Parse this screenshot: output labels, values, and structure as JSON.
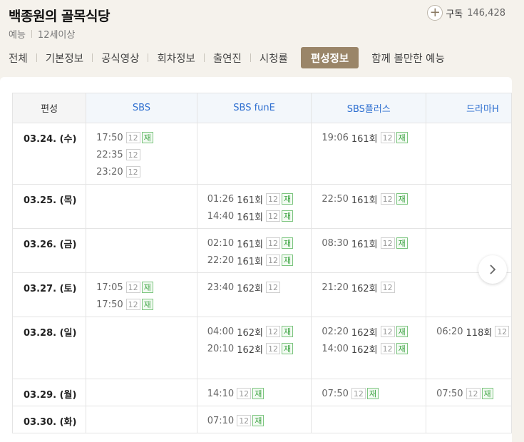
{
  "program": {
    "title": "백종원의 골목식당",
    "genre": "예능",
    "rating": "12세이상"
  },
  "subscribe": {
    "label": "구독",
    "count": "146,428"
  },
  "tabs": [
    {
      "label": "전체",
      "active": false
    },
    {
      "label": "기본정보",
      "active": false
    },
    {
      "label": "공식영상",
      "active": false
    },
    {
      "label": "회차정보",
      "active": false
    },
    {
      "label": "출연진",
      "active": false
    },
    {
      "label": "시청률",
      "active": false
    },
    {
      "label": "편성정보",
      "active": true
    },
    {
      "label": "함께 볼만한 예능",
      "active": false
    }
  ],
  "schedule": {
    "corner_label": "편성",
    "channels": [
      "SBS",
      "SBS funE",
      "SBS플러스",
      "드라마H"
    ],
    "rows": [
      {
        "date": "03.24. (수)",
        "height": 86,
        "cells": [
          [
            {
              "time": "17:50",
              "ep": "",
              "badges": [
                "12",
                "재"
              ]
            },
            {
              "time": "22:35",
              "ep": "",
              "badges": [
                "12"
              ]
            },
            {
              "time": "23:20",
              "ep": "",
              "badges": [
                "12"
              ]
            }
          ],
          [],
          [
            {
              "time": "19:06",
              "ep": "161회",
              "badges": [
                "12",
                "재"
              ]
            }
          ],
          []
        ]
      },
      {
        "date": "03.25. (목)",
        "height": 62,
        "cells": [
          [],
          [
            {
              "time": "01:26",
              "ep": "161회",
              "badges": [
                "12",
                "재"
              ]
            },
            {
              "time": "14:40",
              "ep": "161회",
              "badges": [
                "12",
                "재"
              ]
            }
          ],
          [
            {
              "time": "22:50",
              "ep": "161회",
              "badges": [
                "12",
                "재"
              ]
            }
          ],
          []
        ]
      },
      {
        "date": "03.26. (금)",
        "height": 62,
        "cells": [
          [],
          [
            {
              "time": "02:10",
              "ep": "161회",
              "badges": [
                "12",
                "재"
              ]
            },
            {
              "time": "22:20",
              "ep": "161회",
              "badges": [
                "12",
                "재"
              ]
            }
          ],
          [
            {
              "time": "08:30",
              "ep": "161회",
              "badges": [
                "12",
                "재"
              ]
            }
          ],
          []
        ]
      },
      {
        "date": "03.27. (토)",
        "height": 62,
        "cells": [
          [
            {
              "time": "17:05",
              "ep": "",
              "badges": [
                "12",
                "재"
              ]
            },
            {
              "time": "17:50",
              "ep": "",
              "badges": [
                "12",
                "재"
              ]
            }
          ],
          [
            {
              "time": "23:40",
              "ep": "162회",
              "badges": [
                "12"
              ]
            }
          ],
          [
            {
              "time": "21:20",
              "ep": "162회",
              "badges": [
                "12"
              ]
            }
          ],
          []
        ]
      },
      {
        "date": "03.28. (일)",
        "height": 87,
        "cells": [
          [],
          [
            {
              "time": "04:00",
              "ep": "162회",
              "badges": [
                "12",
                "재"
              ]
            },
            {
              "time": "20:10",
              "ep": "162회",
              "badges": [
                "12",
                "재"
              ]
            }
          ],
          [
            {
              "time": "02:20",
              "ep": "162회",
              "badges": [
                "12",
                "재"
              ]
            },
            {
              "time": "14:00",
              "ep": "162회",
              "badges": [
                "12",
                "재"
              ]
            }
          ],
          [
            {
              "time": "06:20",
              "ep": "118회",
              "badges": [
                "12"
              ]
            }
          ]
        ]
      },
      {
        "date": "03.29. (월)",
        "height": 38,
        "cells": [
          [],
          [
            {
              "time": "14:10",
              "ep": "",
              "badges": [
                "12",
                "재"
              ]
            }
          ],
          [
            {
              "time": "07:50",
              "ep": "",
              "badges": [
                "12",
                "재"
              ]
            }
          ],
          [
            {
              "time": "07:50",
              "ep": "",
              "badges": [
                "12",
                "재"
              ]
            }
          ]
        ]
      },
      {
        "date": "03.30. (화)",
        "height": 38,
        "cells": [
          [],
          [
            {
              "time": "07:10",
              "ep": "",
              "badges": [
                "12",
                "재"
              ]
            }
          ],
          [],
          []
        ]
      }
    ]
  },
  "icons": {
    "subscribe": "plus-icon",
    "next": "chevron-right-icon"
  }
}
